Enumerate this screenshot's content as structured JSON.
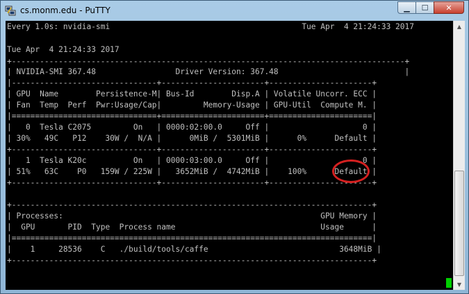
{
  "window": {
    "title": "cs.monm.edu - PuTTY",
    "controls": {
      "minimize": "▁",
      "maximize": "☐",
      "close": "✕"
    }
  },
  "terminal": {
    "lines": [
      "Every 1.0s: nvidia-smi                                         Tue Apr  4 21:24:33 2017",
      "",
      "Tue Apr  4 21:24:33 2017",
      "+------------------------------------------------------------------------------------+",
      "| NVIDIA-SMI 367.48                 Driver Version: 367.48                           |",
      "|-------------------------------+----------------------+----------------------+",
      "| GPU  Name        Persistence-M| Bus-Id        Disp.A | Volatile Uncorr. ECC |",
      "| Fan  Temp  Perf  Pwr:Usage/Cap|         Memory-Usage | GPU-Util  Compute M. |",
      "|===============================+======================+======================|",
      "|   0  Tesla C2075         On   | 0000:02:00.0     Off |                    0 |",
      "| 30%   49C   P12    30W /  N/A |      0MiB /  5301MiB |      0%      Default |",
      "+-------------------------------+----------------------+----------------------+",
      "|   1  Tesla K20c          On   | 0000:03:00.0     Off |                    0 |",
      "| 51%   63C    P0   159W / 225W |   3652MiB /  4742MiB |    100%      Default |",
      "+-------------------------------+----------------------+----------------------+",
      "",
      "+-----------------------------------------------------------------------------+",
      "| Processes:                                                       GPU Memory |",
      "|  GPU       PID  Type  Process name                               Usage      |",
      "|=============================================================================|",
      "|    1     28536    C   ./build/tools/caffe                            3648MiB |",
      "+-----------------------------------------------------------------------------+"
    ]
  },
  "colors": {
    "terminal_bg": "#000000",
    "terminal_fg": "#c0c0c0",
    "cursor": "#00d000",
    "annotation": "#d42020"
  },
  "icons": {
    "app": "putty-icon",
    "scroll_up": "scroll-up-icon",
    "scroll_down": "scroll-down-icon"
  }
}
